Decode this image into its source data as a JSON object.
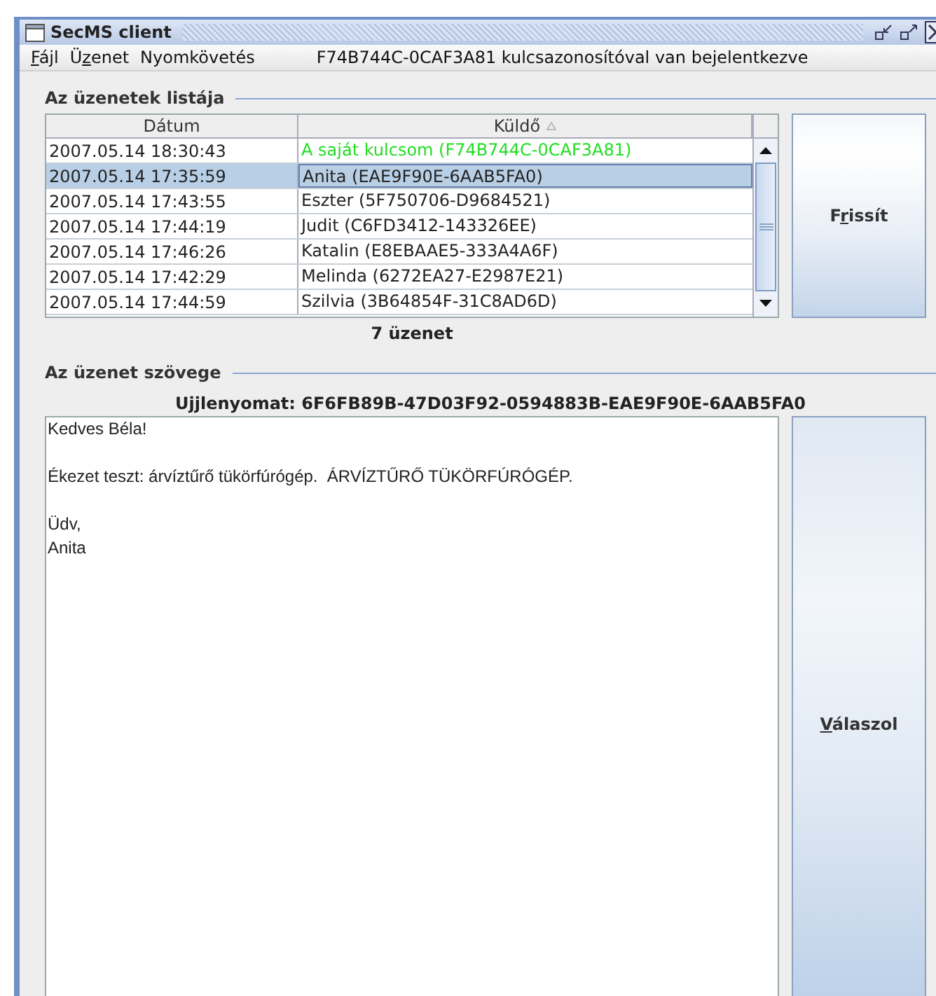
{
  "window": {
    "title": "SecMS client"
  },
  "menu": [
    {
      "key": "F",
      "post": "ájl"
    },
    {
      "pre": "Ü",
      "key": "z",
      "post": "enet"
    },
    {
      "pre": "Nyomkövetés"
    }
  ],
  "login_status": "F74B744C-0CAF3A81 kulcsazonosítóval van bejelentkezve",
  "list_section": {
    "title": "Az üzenetek listája",
    "columns": [
      {
        "label": "Dátum",
        "sorted": false
      },
      {
        "label": "Küldő",
        "sorted": true
      }
    ],
    "rows": [
      {
        "date": "2007.05.14 18:30:43",
        "sender": "A saját kulcsom (F74B744C-0CAF3A81)",
        "kind": "own",
        "selected": false
      },
      {
        "date": "2007.05.14 17:35:59",
        "sender": "Anita (EAE9F90E-6AAB5FA0)",
        "kind": "contact",
        "selected": true
      },
      {
        "date": "2007.05.14 17:43:55",
        "sender": "Eszter (5F750706-D9684521)",
        "kind": "contact",
        "selected": false
      },
      {
        "date": "2007.05.14 17:44:19",
        "sender": "Judit (C6FD3412-143326EE)",
        "kind": "contact",
        "selected": false
      },
      {
        "date": "2007.05.14 17:46:26",
        "sender": "Katalin (E8EBAAE5-333A4A6F)",
        "kind": "contact",
        "selected": false
      },
      {
        "date": "2007.05.14 17:42:29",
        "sender": "Melinda (6272EA27-E2987E21)",
        "kind": "contact",
        "selected": false
      },
      {
        "date": "2007.05.14 17:44:59",
        "sender": "Szilvia (3B64854F-31C8AD6D)",
        "kind": "contact",
        "selected": false
      }
    ],
    "count": "7 üzenet",
    "refresh_button": {
      "pre": "F",
      "key": "r",
      "post": "issít"
    }
  },
  "message_section": {
    "title": "Az üzenet szövege",
    "fingerprint": "Ujjlenyomat: 6F6FB89B-47D03F92-0594883B-EAE9F90E-6AAB5FA0",
    "body": "Kedves Béla!\n\nÉkezet teszt: árvíztűrő tükörfúrógép.  ÁRVÍZTŰRŐ TÜKÖRFÚRÓGÉP.\n\nÜdv,\nAnita",
    "reply_button": {
      "key": "V",
      "post": "álaszol"
    }
  }
}
